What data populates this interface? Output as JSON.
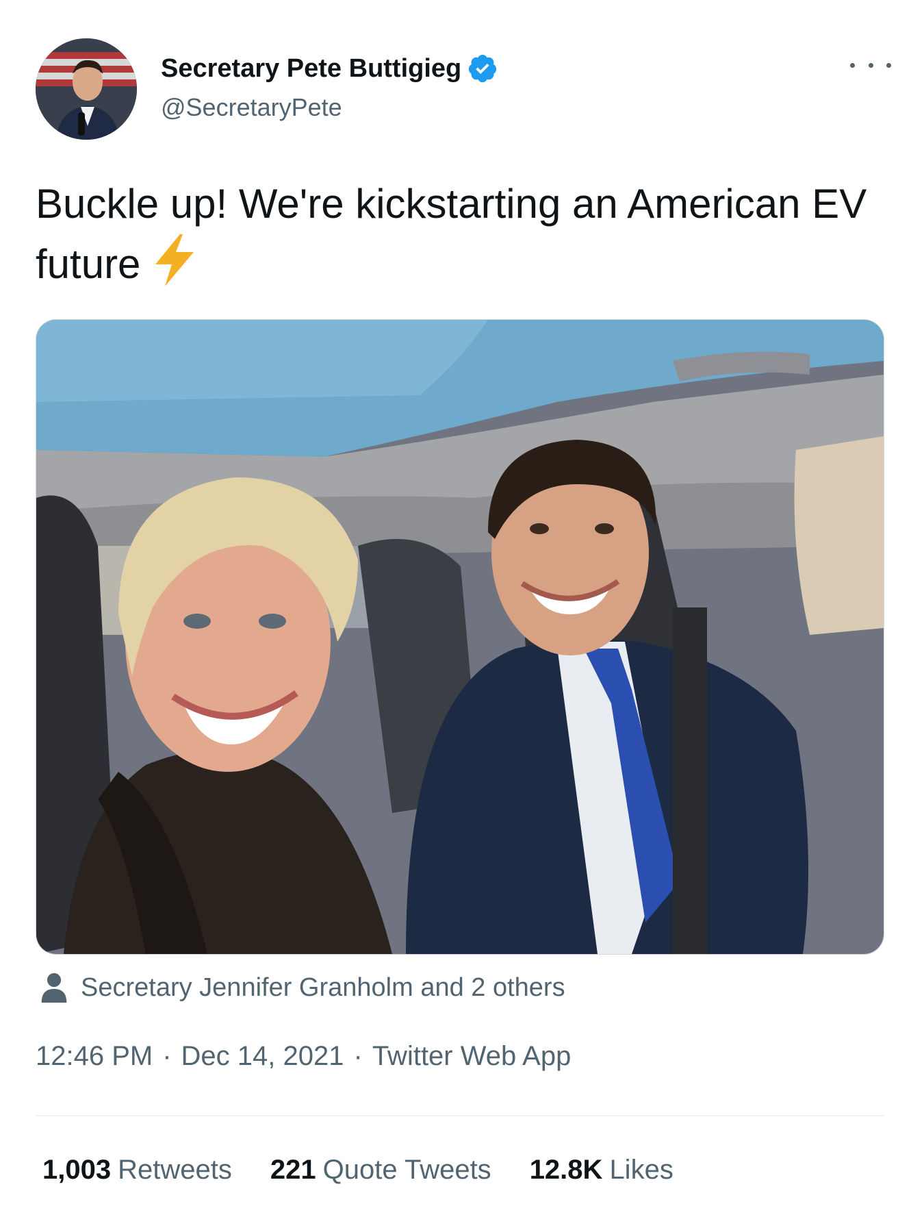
{
  "author": {
    "display_name": "Secretary Pete Buttigieg",
    "handle": "@SecretaryPete",
    "verified_icon": "verified-badge-icon",
    "verified_color": "#1d9bf0"
  },
  "tweet": {
    "text": "Buckle up! We're kickstarting an American EV future",
    "emoji_icon": "high-voltage-icon"
  },
  "media": {
    "tagged_text": "Secretary Jennifer Granholm and 2 others"
  },
  "meta": {
    "time": "12:46 PM",
    "date": "Dec 14, 2021",
    "source": "Twitter Web App",
    "separator": "·"
  },
  "stats": [
    {
      "value": "1,003",
      "label": "Retweets"
    },
    {
      "value": "221",
      "label": "Quote Tweets"
    },
    {
      "value": "12.8K",
      "label": "Likes"
    }
  ],
  "colors": {
    "text_primary": "#0f1419",
    "text_secondary": "#536471",
    "accent": "#1d9bf0",
    "bolt": "#f4b023"
  }
}
